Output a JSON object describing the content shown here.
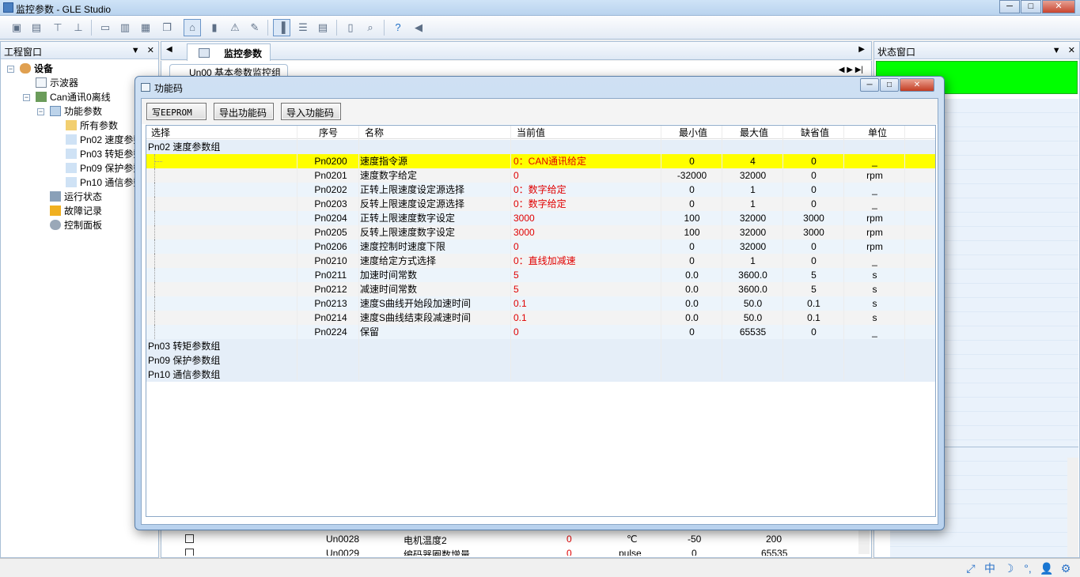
{
  "window": {
    "title": "监控参数 - GLE Studio",
    "controls": {
      "minimize": "─",
      "maximize": "□",
      "close": "✕"
    }
  },
  "toolbar": {
    "icons": [
      "new-icon",
      "open-icon",
      "connect-icon",
      "disconnect-icon",
      "window-icon",
      "import-icon",
      "export-icon",
      "copy-icon",
      "home-icon",
      "device-icon",
      "warning-icon",
      "tool-icon",
      "chart-icon",
      "list-icon",
      "table-icon",
      "panel-icon",
      "zoom-icon",
      "help-icon",
      "exit-icon"
    ]
  },
  "left_pane": {
    "title": "工程窗口",
    "controls": {
      "pin": "▼",
      "close": "✕"
    },
    "tree": [
      {
        "label": "设备",
        "expander": "−"
      },
      {
        "label": "示波器"
      },
      {
        "label": "Can通讯0离线",
        "expander": "−"
      },
      {
        "label": "功能参数",
        "expander": "−"
      },
      {
        "label": "所有参数"
      },
      {
        "label": "Pn02 速度参数组"
      },
      {
        "label": "Pn03 转矩参数组"
      },
      {
        "label": "Pn09 保护参数组"
      },
      {
        "label": "Pn10 通信参数组"
      },
      {
        "label": "运行状态"
      },
      {
        "label": "故障记录"
      },
      {
        "label": "控制面板"
      }
    ]
  },
  "center": {
    "nav_left": "◀",
    "nav_right": "▶",
    "tab": "监控参数",
    "sub_tab": "Un00 基本参数监控组",
    "sub_nav": "◀  ▶  ▶|",
    "background_rows": [
      {
        "code": "Un0028",
        "name": "电机温度2",
        "value": "0",
        "unit": "℃",
        "min": "-50",
        "max": "200"
      },
      {
        "code": "Un0029",
        "name": "编码器圈数增量",
        "value": "0",
        "unit": "pulse",
        "min": "0",
        "max": "65535"
      }
    ]
  },
  "right_pane": {
    "title": "状态窗口",
    "controls": {
      "pin": "▼",
      "close": "✕"
    },
    "status_color": "#00ff00"
  },
  "dialog": {
    "title": "功能码",
    "controls": {
      "minimize": "─",
      "maximize": "□",
      "close": "✕"
    },
    "buttons": {
      "write_eeprom": "写EEPROM",
      "export": "导出功能码",
      "import": "导入功能码"
    },
    "columns": {
      "select": "选择",
      "code": "序号",
      "name": "名称",
      "value": "当前值",
      "min": "最小值",
      "max": "最大值",
      "default": "缺省值",
      "unit": "单位"
    },
    "groups": [
      {
        "label": "Pn02 速度参数组"
      },
      {
        "label": "Pn03 转矩参数组"
      },
      {
        "label": "Pn09 保护参数组"
      },
      {
        "label": "Pn10 通信参数组"
      }
    ],
    "rows": [
      {
        "code": "Pn0200",
        "name": "速度指令源",
        "value": "0：CAN通讯给定",
        "min": "0",
        "max": "4",
        "default": "0",
        "unit": "_"
      },
      {
        "code": "Pn0201",
        "name": "速度数字给定",
        "value": "0",
        "min": "-32000",
        "max": "32000",
        "default": "0",
        "unit": "rpm"
      },
      {
        "code": "Pn0202",
        "name": "正转上限速度设定源选择",
        "value": "0：数字给定",
        "min": "0",
        "max": "1",
        "default": "0",
        "unit": "_"
      },
      {
        "code": "Pn0203",
        "name": "反转上限速度设定源选择",
        "value": "0：数字给定",
        "min": "0",
        "max": "1",
        "default": "0",
        "unit": "_"
      },
      {
        "code": "Pn0204",
        "name": "正转上限速度数字设定",
        "value": "3000",
        "min": "100",
        "max": "32000",
        "default": "3000",
        "unit": "rpm"
      },
      {
        "code": "Pn0205",
        "name": "反转上限速度数字设定",
        "value": "3000",
        "min": "100",
        "max": "32000",
        "default": "3000",
        "unit": "rpm"
      },
      {
        "code": "Pn0206",
        "name": "速度控制时速度下限",
        "value": "0",
        "min": "0",
        "max": "32000",
        "default": "0",
        "unit": "rpm"
      },
      {
        "code": "Pn0210",
        "name": "速度给定方式选择",
        "value": "0：直线加减速",
        "min": "0",
        "max": "1",
        "default": "0",
        "unit": "_"
      },
      {
        "code": "Pn0211",
        "name": "加速时间常数",
        "value": "5",
        "min": "0.0",
        "max": "3600.0",
        "default": "5",
        "unit": "s"
      },
      {
        "code": "Pn0212",
        "name": "减速时间常数",
        "value": "5",
        "min": "0.0",
        "max": "3600.0",
        "default": "5",
        "unit": "s"
      },
      {
        "code": "Pn0213",
        "name": "速度S曲线开始段加速时间",
        "value": "0.1",
        "min": "0.0",
        "max": "50.0",
        "default": "0.1",
        "unit": "s"
      },
      {
        "code": "Pn0214",
        "name": "速度S曲线结束段减速时间",
        "value": "0.1",
        "min": "0.0",
        "max": "50.0",
        "default": "0.1",
        "unit": "s"
      },
      {
        "code": "Pn0224",
        "name": "保留",
        "value": "0",
        "min": "0",
        "max": "65535",
        "default": "0",
        "unit": "_"
      }
    ]
  },
  "tray": {
    "icons": [
      "tray-expand-icon",
      "ime-icon",
      "moon-icon",
      "dots-icon",
      "user-icon",
      "settings-icon"
    ],
    "glyphs": [
      "⤢",
      "中",
      "☽",
      "°,",
      "👤",
      "⚙"
    ]
  }
}
